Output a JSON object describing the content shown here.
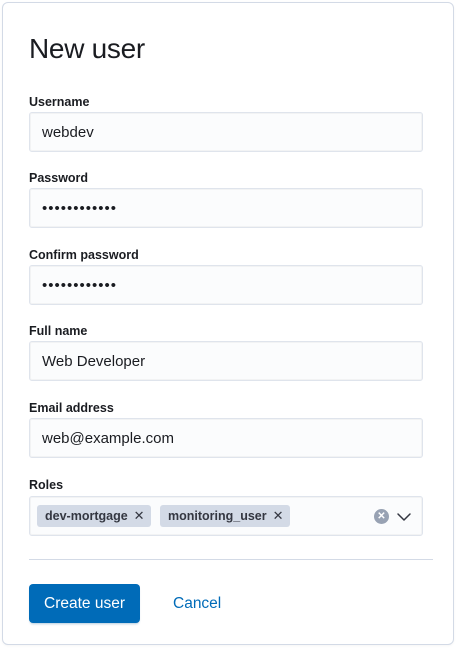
{
  "page": {
    "title": "New user"
  },
  "form": {
    "username": {
      "label": "Username",
      "value": "webdev"
    },
    "password": {
      "label": "Password",
      "value": "••••••••••••"
    },
    "confirm_password": {
      "label": "Confirm password",
      "value": "••••••••••••"
    },
    "full_name": {
      "label": "Full name",
      "value": "Web Developer"
    },
    "email": {
      "label": "Email address",
      "value": "web@example.com"
    },
    "roles": {
      "label": "Roles",
      "selected": [
        "dev-mortgage",
        "monitoring_user"
      ],
      "remove_glyph": "✕",
      "clear_icon": "clear-icon",
      "dropdown_icon": "chevron-down-icon"
    }
  },
  "actions": {
    "create_label": "Create user",
    "cancel_label": "Cancel"
  },
  "colors": {
    "primary": "#006bb8",
    "chip_bg": "#d3dae6",
    "input_bg": "#fbfcfd",
    "border": "#dfe4ec",
    "text": "#1a1c21"
  }
}
